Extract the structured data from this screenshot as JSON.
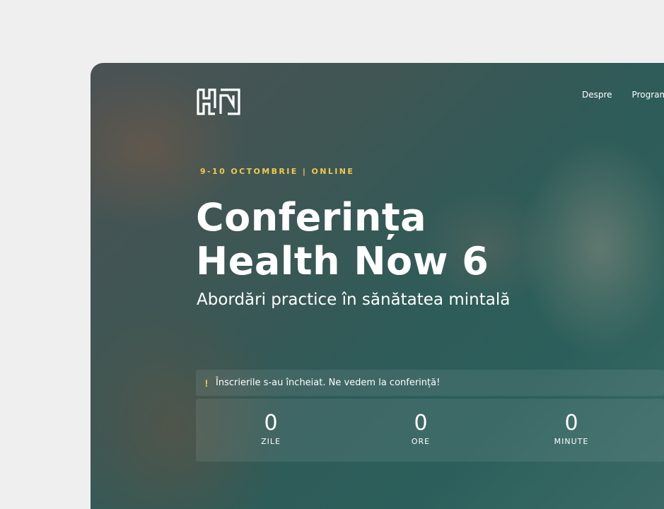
{
  "header": {
    "logo_label": "HN",
    "nav": [
      {
        "label": "Despre"
      },
      {
        "label": "Program"
      }
    ]
  },
  "hero": {
    "eyebrow": "9-10 OCTOMBRIE | ONLINE",
    "title_line1": "Conferința",
    "title_line2": "Health Now 6",
    "subtitle": "Abordări practice în sănătatea mintală",
    "notice": {
      "icon": "exclamation-icon",
      "text": "Înscrierile s-au încheiat. Ne vedem la conferință!"
    },
    "countdown": [
      {
        "value": "0",
        "label": "ZILE"
      },
      {
        "value": "0",
        "label": "ORE"
      },
      {
        "value": "0",
        "label": "MINUTE"
      }
    ]
  },
  "colors": {
    "accent": "#f2c94c",
    "background": "#efefef",
    "hero_overlay": "#2c5f5b",
    "text": "#ffffff"
  }
}
